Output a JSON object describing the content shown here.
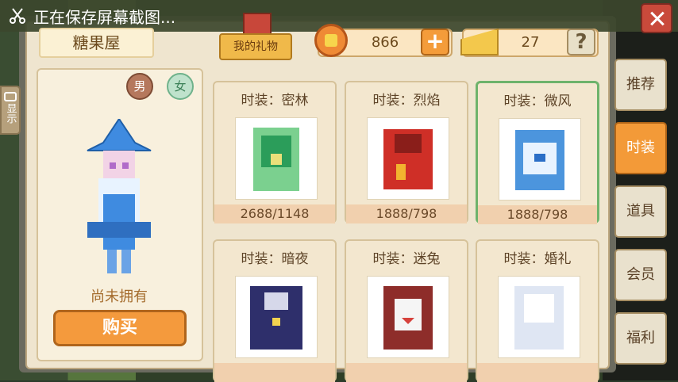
{
  "notice": {
    "text": "正在保存屏幕截图..."
  },
  "shop": {
    "title": "糖果屋"
  },
  "gift": {
    "label": "我的礼物"
  },
  "currency": {
    "coins": "866",
    "cheese": "27"
  },
  "sidebar": {
    "left_tag": "显示"
  },
  "gender": {
    "male": "男",
    "female": "女"
  },
  "preview": {
    "status": "尚未拥有",
    "buy_label": "购买"
  },
  "items": [
    {
      "name": "时装：密林",
      "price": "2688/1148",
      "color": "#7bd08f"
    },
    {
      "name": "时装：烈焰",
      "price": "1888/798",
      "color": "#cf2f27"
    },
    {
      "name": "时装：微风",
      "price": "1888/798",
      "color": "#4c95dd"
    },
    {
      "name": "时装：暗夜",
      "price": "",
      "color": "#2e2f6b"
    },
    {
      "name": "时装：迷兔",
      "price": "",
      "color": "#8e2d2a"
    },
    {
      "name": "时装：婚礼",
      "price": "",
      "color": "#dfe6f3"
    }
  ],
  "tabs": [
    {
      "label": "推荐"
    },
    {
      "label": "时装"
    },
    {
      "label": "道具"
    },
    {
      "label": "会员"
    },
    {
      "label": "福利"
    }
  ]
}
